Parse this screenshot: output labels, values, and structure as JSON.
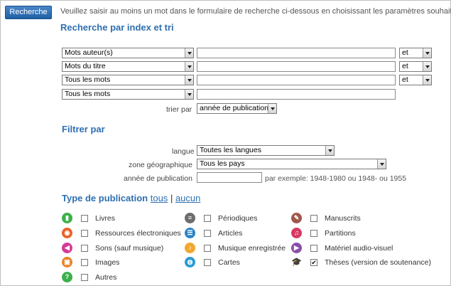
{
  "header": {
    "search_button": "Recherche",
    "intro": "Veuillez saisir au moins un mot dans le formulaire de recherche ci-dessous en choisissant les paramètres souhaités"
  },
  "index_section": {
    "title": "Recherche par index et tri",
    "rows": [
      {
        "field": "Mots auteur(s)",
        "value": "",
        "operator": "et"
      },
      {
        "field": "Mots du titre",
        "value": "",
        "operator": "et"
      },
      {
        "field": "Tous les mots",
        "value": "",
        "operator": "et"
      },
      {
        "field": "Tous les mots",
        "value": ""
      }
    ],
    "sort_label": "trier par",
    "sort_value": "année de publication"
  },
  "filter_section": {
    "title": "Filtrer par",
    "language_label": "langue",
    "language_value": "Toutes les langues",
    "zone_label": "zone géographique",
    "zone_value": "Tous les pays",
    "year_label": "année de publication",
    "year_value": "",
    "year_hint": "par exemple: 1948-1980 ou 1948- ou 1955"
  },
  "publication_section": {
    "title": "Type de publication",
    "all_link": "tous",
    "separator": "|",
    "none_link": "aucun",
    "items": [
      {
        "label": "Livres",
        "icon": "book-icon",
        "color": "#3cb04a",
        "checked": false
      },
      {
        "label": "Périodiques",
        "icon": "periodical-icon",
        "color": "#6d6d6d",
        "checked": false
      },
      {
        "label": "Manuscrits",
        "icon": "manuscript-icon",
        "color": "#a0564a",
        "checked": false
      },
      {
        "label": "Ressources électroniques",
        "icon": "electronic-resource-icon",
        "color": "#e8622a",
        "checked": false
      },
      {
        "label": "Articles",
        "icon": "article-icon",
        "color": "#2a83c6",
        "checked": false
      },
      {
        "label": "Partitions",
        "icon": "score-icon",
        "color": "#d63a63",
        "checked": false
      },
      {
        "label": "Sons (sauf musique)",
        "icon": "sound-icon",
        "color": "#d43a9a",
        "checked": false
      },
      {
        "label": "Musique enregistrée",
        "icon": "recorded-music-icon",
        "color": "#f0a830",
        "checked": false
      },
      {
        "label": "Matériel audio-visuel",
        "icon": "audiovisual-icon",
        "color": "#8a4fa8",
        "checked": false
      },
      {
        "label": "Images",
        "icon": "image-icon",
        "color": "#e8842a",
        "checked": false
      },
      {
        "label": "Cartes",
        "icon": "map-icon",
        "color": "#2a9ad6",
        "checked": false
      },
      {
        "label": "Thèses (version de soutenance)",
        "icon": "thesis-icon",
        "color": "#222222",
        "checked": true
      },
      {
        "label": "Autres",
        "icon": "other-icon",
        "color": "#3cb04a",
        "checked": false
      }
    ]
  },
  "colors": {
    "accent": "#2e6fb0",
    "button": "#1f5fa5"
  }
}
